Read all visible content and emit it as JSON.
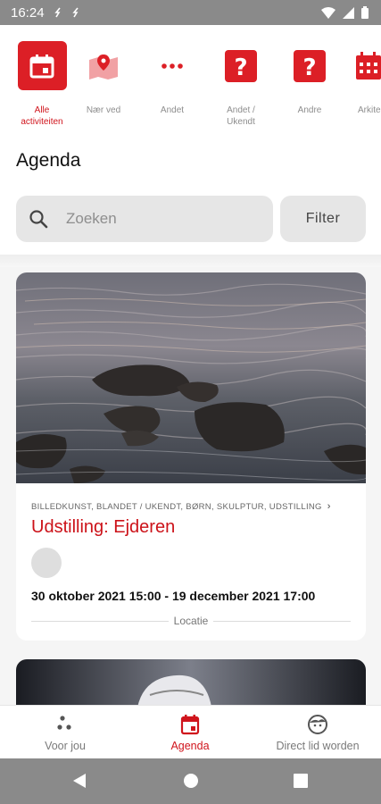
{
  "status_bar": {
    "time": "16:24"
  },
  "categories": [
    {
      "label": "Alle\nactiviteiten",
      "icon": "calendar-icon",
      "active": true
    },
    {
      "label": "Nær ved",
      "icon": "map-icon",
      "active": false
    },
    {
      "label": "Andet",
      "icon": "more-dots-icon",
      "active": false
    },
    {
      "label": "Andet /\nUkendt",
      "icon": "question-icon",
      "active": false
    },
    {
      "label": "Andre",
      "icon": "question-icon",
      "active": false
    },
    {
      "label": "Arkite",
      "icon": "calendar-grid-icon",
      "active": false
    }
  ],
  "page_title": "Agenda",
  "search": {
    "placeholder": "Zoeken",
    "value": ""
  },
  "filter_label": "Filter",
  "event": {
    "categories": "BILLEDKUNST, BLANDET / UKENDT, BØRN, SKULPTUR, UDSTILLING",
    "title": "Udstilling: Ejderen",
    "dates": "30 oktober 2021 15:00 - 19 december 2021 17:00",
    "location_label": "Locatie"
  },
  "bottom_nav": [
    {
      "label": "Voor jou",
      "icon": "dots-icon",
      "active": false
    },
    {
      "label": "Agenda",
      "icon": "calendar-icon",
      "active": true
    },
    {
      "label": "Direct lid worden",
      "icon": "face-icon",
      "active": false
    }
  ],
  "colors": {
    "accent": "#dc1f26",
    "status_bar": "#8a8a8a",
    "background": "#ffffff"
  }
}
